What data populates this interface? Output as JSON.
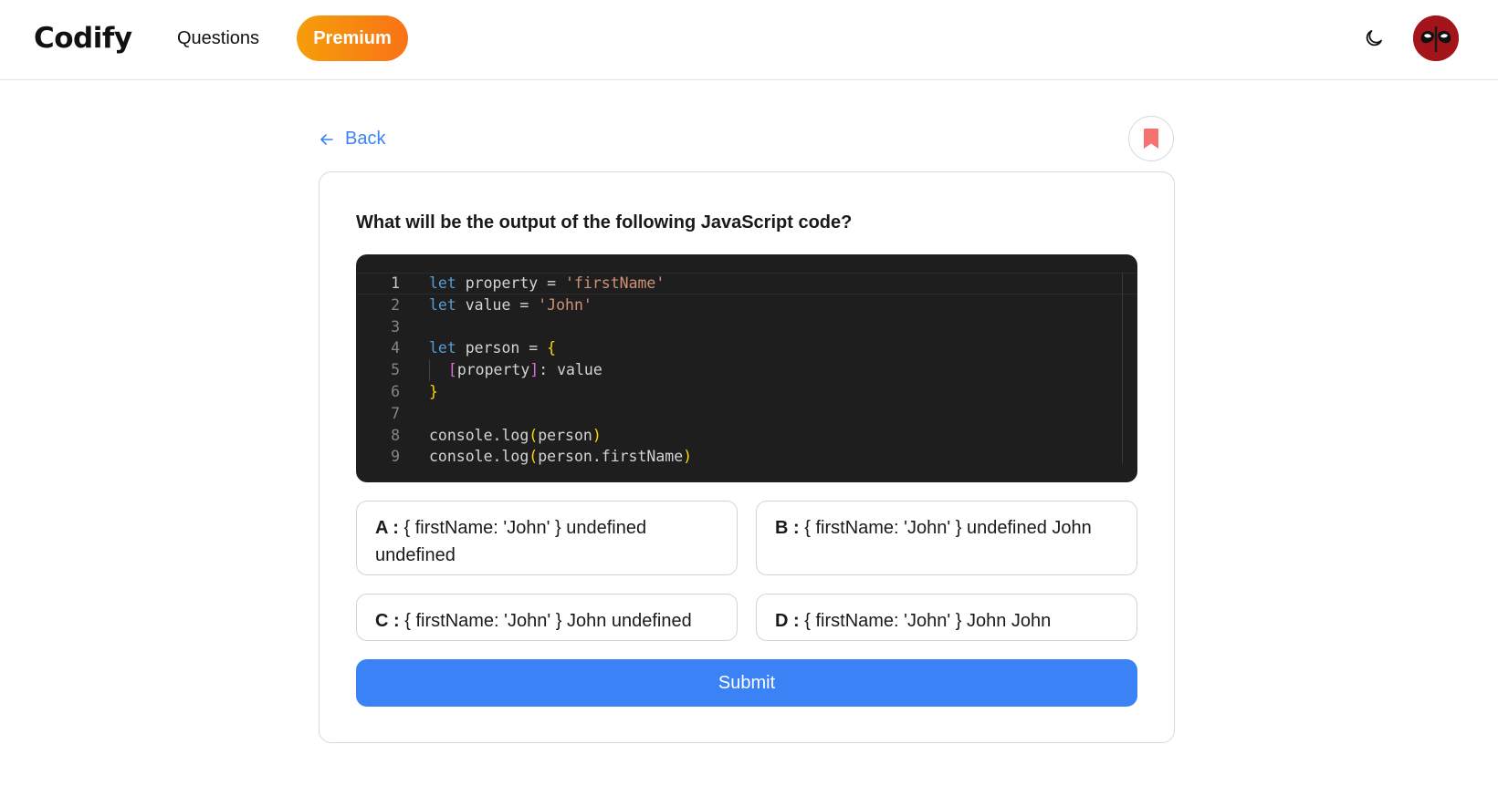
{
  "header": {
    "logo": "Codify",
    "nav_questions": "Questions",
    "premium_label": "Premium",
    "theme_icon": "moon-icon",
    "avatar_icon": "avatar-mask"
  },
  "page": {
    "back_label": "Back",
    "back_icon": "arrow-left-icon",
    "bookmark_icon": "bookmark-icon",
    "question": "What will be the output of the following JavaScript code?"
  },
  "code": {
    "line_numbers": [
      "1",
      "2",
      "3",
      "4",
      "5",
      "6",
      "7",
      "8",
      "9"
    ],
    "lines": [
      "let property = 'firstName'",
      "let value = 'John'",
      "",
      "let person = {",
      "  [property]: value",
      "}",
      "",
      "console.log(person)",
      "console.log(person.firstName)"
    ]
  },
  "options": [
    {
      "letter": "A :",
      "text": "{ firstName: 'John' } undefined undefined"
    },
    {
      "letter": "B :",
      "text": "{ firstName: 'John' } undefined John"
    },
    {
      "letter": "C :",
      "text": "{ firstName: 'John' } John undefined"
    },
    {
      "letter": "D :",
      "text": "{ firstName: 'John' } John John"
    }
  ],
  "submit_label": "Submit",
  "colors": {
    "accent": "#3b82f6",
    "premium_start": "#f59e0b",
    "premium_end": "#f97316",
    "bookmark": "#f87171",
    "avatar_bg": "#a3151b",
    "code_bg": "#1e1e1e"
  }
}
